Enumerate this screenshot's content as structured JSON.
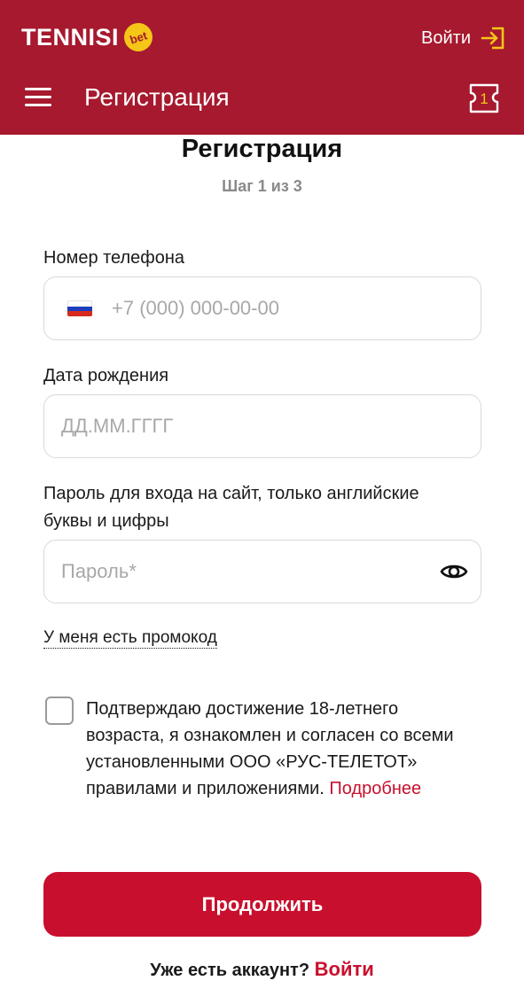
{
  "header": {
    "logo_text": "TENNISI",
    "logo_badge": "bet",
    "login_label": "Войти",
    "nav_title": "Регистрация",
    "coupon_count": "1",
    "brand_color": "#a6192e",
    "accent_color": "#f5c518"
  },
  "main": {
    "title": "Регистрация",
    "step": "Шаг 1 из 3",
    "phone": {
      "label": "Номер телефона",
      "placeholder": "+7 (000) 000-00-00",
      "flag_icon": "russia-flag-icon"
    },
    "birthdate": {
      "label": "Дата рождения",
      "placeholder": "ДД.ММ.ГГГГ"
    },
    "password": {
      "label_line1": "Пароль для входа на сайт, только английские",
      "label_line2": "буквы и цифры",
      "placeholder": "Пароль*",
      "toggle_icon": "eye-icon"
    },
    "promo_link": "У меня есть промокод",
    "consent": {
      "text": "Подтверждаю достижение 18-летнего возраста, я ознакомлен и согласен со всеми установленными ООО «РУС-ТЕЛЕТОТ» правилами и приложениями.",
      "more_link": "Подробнее",
      "checked": false
    },
    "continue_label": "Продолжить",
    "account_text": "Уже есть аккаунт?",
    "account_login": "Войти",
    "button_color": "#c8102e"
  }
}
